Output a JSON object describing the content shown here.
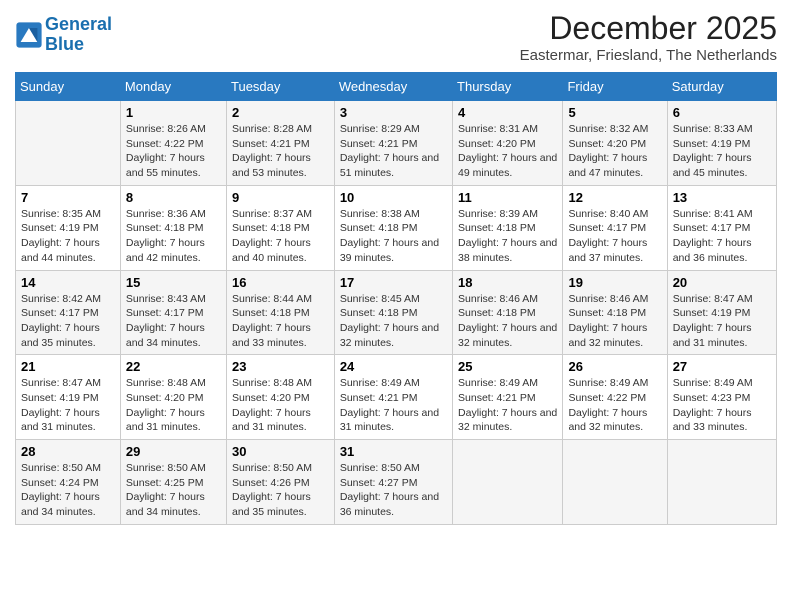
{
  "logo": {
    "line1": "General",
    "line2": "Blue"
  },
  "title": "December 2025",
  "location": "Eastermar, Friesland, The Netherlands",
  "days_of_week": [
    "Sunday",
    "Monday",
    "Tuesday",
    "Wednesday",
    "Thursday",
    "Friday",
    "Saturday"
  ],
  "weeks": [
    [
      {
        "day": "",
        "sunrise": "",
        "sunset": "",
        "daylight": ""
      },
      {
        "day": "1",
        "sunrise": "Sunrise: 8:26 AM",
        "sunset": "Sunset: 4:22 PM",
        "daylight": "Daylight: 7 hours and 55 minutes."
      },
      {
        "day": "2",
        "sunrise": "Sunrise: 8:28 AM",
        "sunset": "Sunset: 4:21 PM",
        "daylight": "Daylight: 7 hours and 53 minutes."
      },
      {
        "day": "3",
        "sunrise": "Sunrise: 8:29 AM",
        "sunset": "Sunset: 4:21 PM",
        "daylight": "Daylight: 7 hours and 51 minutes."
      },
      {
        "day": "4",
        "sunrise": "Sunrise: 8:31 AM",
        "sunset": "Sunset: 4:20 PM",
        "daylight": "Daylight: 7 hours and 49 minutes."
      },
      {
        "day": "5",
        "sunrise": "Sunrise: 8:32 AM",
        "sunset": "Sunset: 4:20 PM",
        "daylight": "Daylight: 7 hours and 47 minutes."
      },
      {
        "day": "6",
        "sunrise": "Sunrise: 8:33 AM",
        "sunset": "Sunset: 4:19 PM",
        "daylight": "Daylight: 7 hours and 45 minutes."
      }
    ],
    [
      {
        "day": "7",
        "sunrise": "Sunrise: 8:35 AM",
        "sunset": "Sunset: 4:19 PM",
        "daylight": "Daylight: 7 hours and 44 minutes."
      },
      {
        "day": "8",
        "sunrise": "Sunrise: 8:36 AM",
        "sunset": "Sunset: 4:18 PM",
        "daylight": "Daylight: 7 hours and 42 minutes."
      },
      {
        "day": "9",
        "sunrise": "Sunrise: 8:37 AM",
        "sunset": "Sunset: 4:18 PM",
        "daylight": "Daylight: 7 hours and 40 minutes."
      },
      {
        "day": "10",
        "sunrise": "Sunrise: 8:38 AM",
        "sunset": "Sunset: 4:18 PM",
        "daylight": "Daylight: 7 hours and 39 minutes."
      },
      {
        "day": "11",
        "sunrise": "Sunrise: 8:39 AM",
        "sunset": "Sunset: 4:18 PM",
        "daylight": "Daylight: 7 hours and 38 minutes."
      },
      {
        "day": "12",
        "sunrise": "Sunrise: 8:40 AM",
        "sunset": "Sunset: 4:17 PM",
        "daylight": "Daylight: 7 hours and 37 minutes."
      },
      {
        "day": "13",
        "sunrise": "Sunrise: 8:41 AM",
        "sunset": "Sunset: 4:17 PM",
        "daylight": "Daylight: 7 hours and 36 minutes."
      }
    ],
    [
      {
        "day": "14",
        "sunrise": "Sunrise: 8:42 AM",
        "sunset": "Sunset: 4:17 PM",
        "daylight": "Daylight: 7 hours and 35 minutes."
      },
      {
        "day": "15",
        "sunrise": "Sunrise: 8:43 AM",
        "sunset": "Sunset: 4:17 PM",
        "daylight": "Daylight: 7 hours and 34 minutes."
      },
      {
        "day": "16",
        "sunrise": "Sunrise: 8:44 AM",
        "sunset": "Sunset: 4:18 PM",
        "daylight": "Daylight: 7 hours and 33 minutes."
      },
      {
        "day": "17",
        "sunrise": "Sunrise: 8:45 AM",
        "sunset": "Sunset: 4:18 PM",
        "daylight": "Daylight: 7 hours and 32 minutes."
      },
      {
        "day": "18",
        "sunrise": "Sunrise: 8:46 AM",
        "sunset": "Sunset: 4:18 PM",
        "daylight": "Daylight: 7 hours and 32 minutes."
      },
      {
        "day": "19",
        "sunrise": "Sunrise: 8:46 AM",
        "sunset": "Sunset: 4:18 PM",
        "daylight": "Daylight: 7 hours and 32 minutes."
      },
      {
        "day": "20",
        "sunrise": "Sunrise: 8:47 AM",
        "sunset": "Sunset: 4:19 PM",
        "daylight": "Daylight: 7 hours and 31 minutes."
      }
    ],
    [
      {
        "day": "21",
        "sunrise": "Sunrise: 8:47 AM",
        "sunset": "Sunset: 4:19 PM",
        "daylight": "Daylight: 7 hours and 31 minutes."
      },
      {
        "day": "22",
        "sunrise": "Sunrise: 8:48 AM",
        "sunset": "Sunset: 4:20 PM",
        "daylight": "Daylight: 7 hours and 31 minutes."
      },
      {
        "day": "23",
        "sunrise": "Sunrise: 8:48 AM",
        "sunset": "Sunset: 4:20 PM",
        "daylight": "Daylight: 7 hours and 31 minutes."
      },
      {
        "day": "24",
        "sunrise": "Sunrise: 8:49 AM",
        "sunset": "Sunset: 4:21 PM",
        "daylight": "Daylight: 7 hours and 31 minutes."
      },
      {
        "day": "25",
        "sunrise": "Sunrise: 8:49 AM",
        "sunset": "Sunset: 4:21 PM",
        "daylight": "Daylight: 7 hours and 32 minutes."
      },
      {
        "day": "26",
        "sunrise": "Sunrise: 8:49 AM",
        "sunset": "Sunset: 4:22 PM",
        "daylight": "Daylight: 7 hours and 32 minutes."
      },
      {
        "day": "27",
        "sunrise": "Sunrise: 8:49 AM",
        "sunset": "Sunset: 4:23 PM",
        "daylight": "Daylight: 7 hours and 33 minutes."
      }
    ],
    [
      {
        "day": "28",
        "sunrise": "Sunrise: 8:50 AM",
        "sunset": "Sunset: 4:24 PM",
        "daylight": "Daylight: 7 hours and 34 minutes."
      },
      {
        "day": "29",
        "sunrise": "Sunrise: 8:50 AM",
        "sunset": "Sunset: 4:25 PM",
        "daylight": "Daylight: 7 hours and 34 minutes."
      },
      {
        "day": "30",
        "sunrise": "Sunrise: 8:50 AM",
        "sunset": "Sunset: 4:26 PM",
        "daylight": "Daylight: 7 hours and 35 minutes."
      },
      {
        "day": "31",
        "sunrise": "Sunrise: 8:50 AM",
        "sunset": "Sunset: 4:27 PM",
        "daylight": "Daylight: 7 hours and 36 minutes."
      },
      {
        "day": "",
        "sunrise": "",
        "sunset": "",
        "daylight": ""
      },
      {
        "day": "",
        "sunrise": "",
        "sunset": "",
        "daylight": ""
      },
      {
        "day": "",
        "sunrise": "",
        "sunset": "",
        "daylight": ""
      }
    ]
  ]
}
